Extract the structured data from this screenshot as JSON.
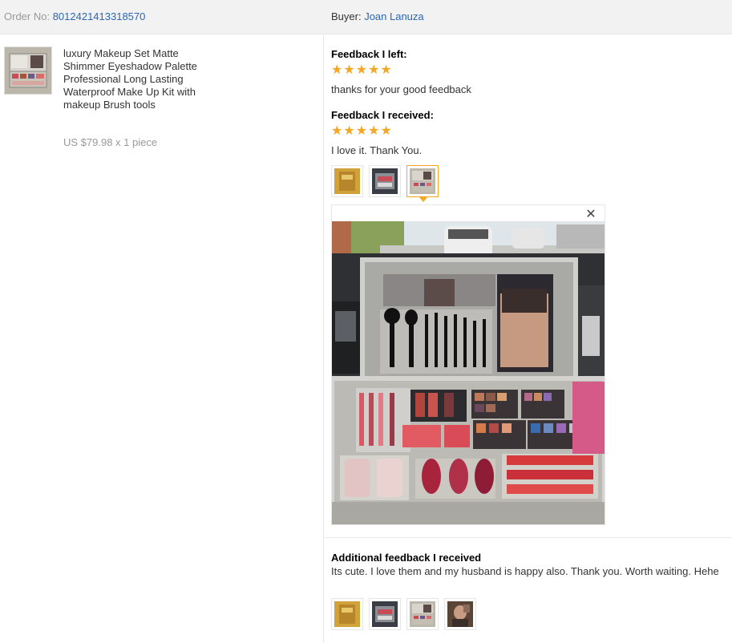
{
  "header": {
    "order_label": "Order No: ",
    "order_number": "8012421413318570",
    "buyer_label": "Buyer: ",
    "buyer_name": "Joan Lanuza"
  },
  "product": {
    "title": "luxury Makeup Set Matte Shimmer Eyeshadow Palette Professional Long Lasting Waterproof Make Up Kit with makeup Brush tools",
    "price": "US $79.98 x 1 piece"
  },
  "feedback_left": {
    "label": "Feedback I left:",
    "stars": "★★★★★",
    "rating": 5,
    "text": "thanks for your good feedback"
  },
  "feedback_received": {
    "label": "Feedback I received:",
    "stars": "★★★★★",
    "rating": 5,
    "text": "I love it. Thank You."
  },
  "viewer": {
    "close_glyph": "✕"
  },
  "additional_feedback": {
    "label": "Additional feedback I received",
    "text": "Its cute. I love them and my husband is happy also. Thank you. Worth waiting. Hehe"
  },
  "colors": {
    "link": "#2a66b3",
    "star": "#f5a623",
    "active_border": "#f5a623"
  }
}
